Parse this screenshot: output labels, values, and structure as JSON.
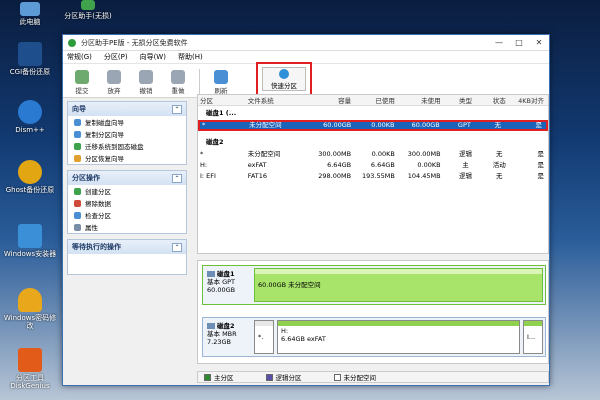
{
  "desktop": {
    "icons": [
      {
        "label": "此电脑",
        "color": "#5c9bd6"
      },
      {
        "label": "分区助手(无损)",
        "color": "#3ea34a"
      },
      {
        "label": "CGI备份还原",
        "color": "#1f4e8c"
      },
      {
        "label": "Dism++",
        "color": "#2b7ad1"
      },
      {
        "label": "Ghost备份还原",
        "color": "#e3a613"
      },
      {
        "label": "Windows安装器",
        "color": "#3b8fd6"
      },
      {
        "label": "Windows密码修改",
        "color": "#e9a81b"
      },
      {
        "label": "分区工具DiskGenius",
        "color": "#e25b18"
      }
    ]
  },
  "window": {
    "title": "分区助手PE版 - 无损分区免费软件",
    "min": "—",
    "max": "□",
    "close": "✕"
  },
  "menu": [
    "常规(G)",
    "分区(P)",
    "向导(W)",
    "帮助(H)"
  ],
  "toolbar": {
    "items": [
      "提交",
      "放弃",
      "撤销",
      "重做"
    ],
    "refresh": "刷新",
    "quick": "快速分区"
  },
  "wizard": {
    "title": "向导",
    "collapse": "⌃",
    "items": [
      "复制磁盘向导",
      "复制分区向导",
      "迁移系统到固态磁盘",
      "分区恢复向导"
    ]
  },
  "ops": {
    "title": "分区操作",
    "collapse": "⌃",
    "items": [
      "创建分区",
      "擦除数据",
      "检查分区",
      "属性"
    ]
  },
  "pending": {
    "title": "等待执行的操作",
    "collapse": "⌃"
  },
  "table": {
    "headers": [
      "分区",
      "文件系统",
      "容量",
      "已使用",
      "未使用",
      "类型",
      "状态",
      "4KB对齐"
    ],
    "disk1": "磁盘1 (...",
    "disk1_rows": [
      [
        "*",
        "未分配空间",
        "60.00GB",
        "0.00KB",
        "60.00GB",
        "GPT",
        "无",
        "是"
      ]
    ],
    "disk2": "磁盘2",
    "disk2_rows": [
      [
        "*",
        "未分配空间",
        "300.00MB",
        "0.00KB",
        "300.00MB",
        "逻辑",
        "无",
        "是"
      ],
      [
        "H:",
        "exFAT",
        "6.64GB",
        "6.64GB",
        "0.00KB",
        "主",
        "活动",
        "是"
      ],
      [
        "I: EFI",
        "FAT16",
        "298.00MB",
        "193.55MB",
        "104.45MB",
        "逻辑",
        "无",
        "是"
      ]
    ]
  },
  "map": {
    "disk1": {
      "name": "磁盘1",
      "type": "基本 GPT",
      "size": "60.00GB",
      "part": "60.00GB 未分配空间"
    },
    "disk2": {
      "name": "磁盘2",
      "type": "基本 MBR",
      "size": "7.23GB",
      "part1": "*.",
      "part2_l1": "H:",
      "part2_l2": "6.64GB exFAT",
      "part3": "I..."
    }
  },
  "legend": [
    "主分区",
    "逻辑分区",
    "未分配空间"
  ],
  "colors": {
    "primary": "#2f8a2f",
    "logical": "#5a4fa8",
    "unalloc": "#a8e36a",
    "selected": "#1a63b8",
    "highlight": "#e02020"
  }
}
